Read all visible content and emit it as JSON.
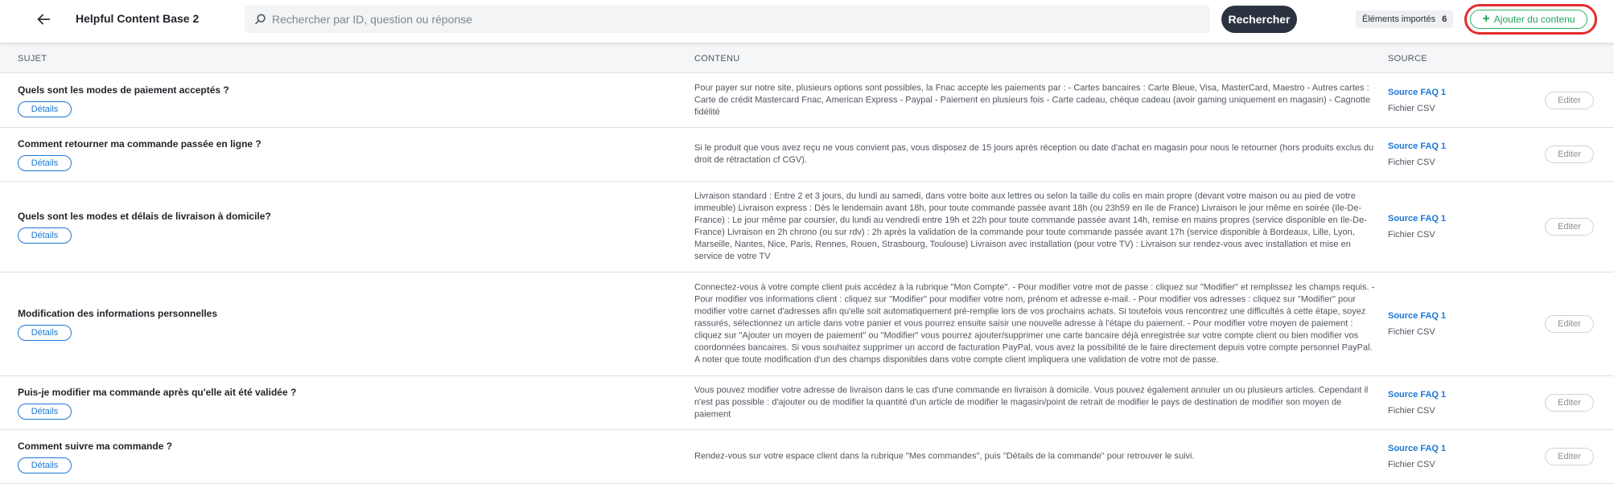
{
  "header": {
    "back_icon": "arrow-left-icon",
    "title": "Helpful Content Base 2",
    "search_placeholder": "Rechercher par ID, question ou réponse",
    "search_icon": "search-icon",
    "search_button": "Rechercher",
    "imported_label": "Éléments importés",
    "imported_count": "6",
    "add_button": "Ajouter du contenu",
    "add_icon": "plus-icon",
    "highlight_color": "#e32b2b",
    "accent_color": "#2fb56a"
  },
  "columns": {
    "subject": "SUJET",
    "content": "CONTENU",
    "source": "SOURCE"
  },
  "rows": [
    {
      "subject": "Quels sont les modes de paiement acceptés ?",
      "details": "Détails",
      "content": "Pour payer sur notre site, plusieurs options sont possibles, la Fnac accepte les paiements par : - Cartes bancaires : Carte Bleue, Visa, MasterCard, Maestro - Autres cartes : Carte de crédit Mastercard Fnac, American Express - Paypal - Paiement en plusieurs fois - Carte cadeau, chèque cadeau (avoir gaming uniquement en magasin) - Cagnotte fidélité",
      "source": "Source FAQ 1",
      "source_type": "Fichier CSV",
      "edit": "Editer"
    },
    {
      "subject": "Comment retourner ma commande passée en ligne ?",
      "details": "Détails",
      "content": "Si le produit que vous avez reçu ne vous convient pas, vous disposez de 15 jours après réception ou date d'achat en magasin pour nous le retourner (hors produits exclus du droit de rétractation cf CGV).",
      "source": "Source FAQ 1",
      "source_type": "Fichier CSV",
      "edit": "Editer"
    },
    {
      "subject": "Quels sont les modes et délais de livraison à domicile?",
      "details": "Détails",
      "content": "Livraison standard : Entre 2 et 3 jours, du lundi au samedi, dans votre boite aux lettres ou selon la taille du colis en main propre (devant votre maison ou au pied de votre immeuble) Livraison express : Dès le lendemain avant 18h, pour toute commande passée avant 18h (ou 23h59 en Ile de France) Livraison le jour même en soirée (Ile-De-France) : Le jour même par coursier, du lundi au vendredi entre 19h et 22h pour toute commande passée avant 14h, remise en mains propres (service disponible en Ile-De-France) Livraison en 2h chrono (ou sur rdv) : 2h après la validation de la commande pour toute commande passée avant 17h (service disponible à Bordeaux, Lille, Lyon, Marseille, Nantes, Nice, Paris, Rennes, Rouen, Strasbourg, Toulouse) Livraison avec installation (pour votre TV) : Livraison sur rendez-vous avec installation et mise en service de votre TV",
      "source": "Source FAQ 1",
      "source_type": "Fichier CSV",
      "edit": "Editer"
    },
    {
      "subject": "Modification des informations personnelles",
      "details": "Détails",
      "content": "Connectez-vous à votre compte client puis accédez à la rubrique \"Mon Compte\". - Pour modifier votre mot de passe : cliquez sur \"Modifier\" et remplissez les champs requis. - Pour modifier vos informations client : cliquez sur \"Modifier\" pour modifier votre nom, prénom et adresse e-mail. - Pour modifier vos adresses : cliquez sur \"Modifier\" pour modifier votre carnet d'adresses afin qu'elle soit automatiquement pré-remplie lors de vos prochains achats. Si toutefois vous rencontrez une difficultés à cette étape, soyez rassurés, sélectionnez un article dans votre panier et vous pourrez ensuite saisir une nouvelle adresse à l'étape du paiement. - Pour modifier votre moyen de paiement : cliquez sur \"Ajouter un moyen de paiement\" ou \"Modifier\" vous pourrez ajouter/supprimer une carte bancaire déjà enregistrée sur votre compte client ou bien modifier vos coordonnées bancaires. Si vous souhaitez supprimer un accord de facturation PayPal, vous avez la possibilité de le faire directement depuis votre compte personnel PayPal. A noter que toute modification d'un des champs disponibles dans votre compte client impliquera une validation de votre mot de passe.",
      "source": "Source FAQ 1",
      "source_type": "Fichier CSV",
      "edit": "Editer"
    },
    {
      "subject": "Puis-je modifier ma commande après qu'elle ait été validée ?",
      "details": "Détails",
      "content": "Vous pouvez modifier votre adresse de livraison dans le cas d'une commande en livraison à domicile. Vous pouvez également annuler un ou plusieurs articles. Cependant il n'est pas possible : d'ajouter ou de modifier la quantité d'un article de modifier le magasin/point de retrait de modifier le pays de destination de modifier son moyen de paiement",
      "source": "Source FAQ 1",
      "source_type": "Fichier CSV",
      "edit": "Editer"
    },
    {
      "subject": "Comment suivre ma commande ?",
      "details": "Détails",
      "content": "Rendez-vous sur votre espace client dans la rubrique \"Mes commandes\", puis \"Détails de la commande\" pour retrouver le suivi.",
      "source": "Source FAQ 1",
      "source_type": "Fichier CSV",
      "edit": "Editer"
    }
  ]
}
